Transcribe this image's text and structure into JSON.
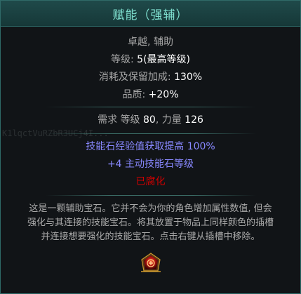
{
  "header": {
    "title": "赋能（强辅）"
  },
  "properties": {
    "tags": "卓越, 辅助",
    "level": {
      "label": "等级: ",
      "value": "5(最高等级)"
    },
    "cost": {
      "label": "消耗及保留加成: ",
      "value": "130%"
    },
    "quality": {
      "label": "品质: ",
      "value": "+20%"
    }
  },
  "requirements": {
    "prefix": "需求 ",
    "level_label": "等级 ",
    "level_value": "80",
    "sep": ", ",
    "str_label": "力量 ",
    "str_value": "126"
  },
  "watermark": "K1lqctVuRZbR3UCj4I...",
  "mods": [
    "技能石经验值获取提高 100%",
    "+4 主动技能石等级"
  ],
  "corrupted": "已腐化",
  "description": [
    "这是一颗辅助宝石。它并不会为你的角色增加属性数值, 但会",
    "强化与其连接的技能宝石。将其放置于物品上同样颜色的插槽",
    "并连接想要强化的技能宝石。点击右键从插槽中移除。"
  ],
  "icon": "red-support-gem-icon",
  "colors": {
    "header_text": "#7fe0d0",
    "mod_blue": "#8888ff",
    "corrupted_red": "#d20000",
    "border": "#2f6a68"
  }
}
